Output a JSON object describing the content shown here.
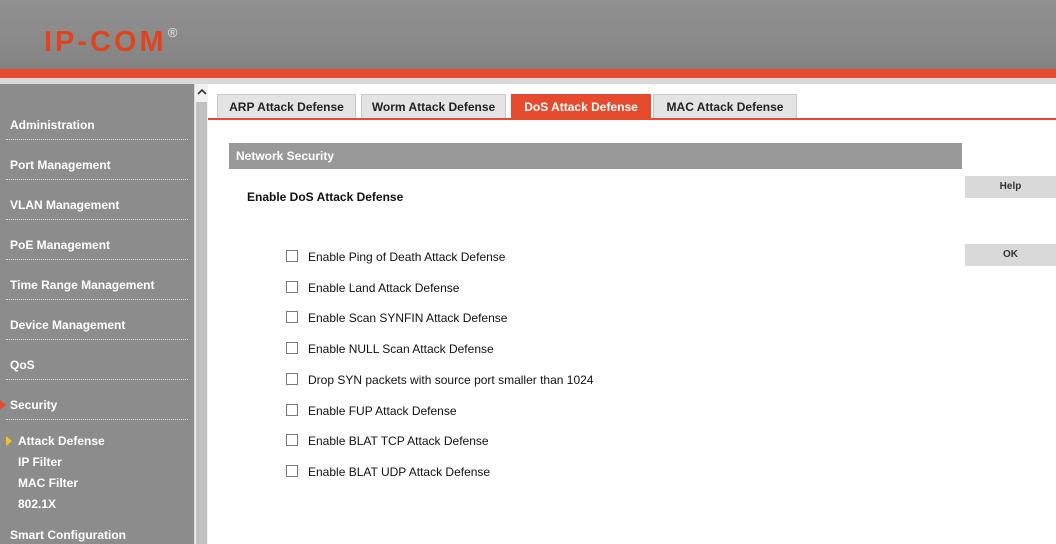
{
  "header": {
    "logo_text": "IP-COM",
    "logo_mark": "®",
    "accent_color": "#e54b2c"
  },
  "sidebar": {
    "items": [
      {
        "label": "Administration"
      },
      {
        "label": "Port Management"
      },
      {
        "label": "VLAN Management"
      },
      {
        "label": "PoE Management"
      },
      {
        "label": "Time Range Management"
      },
      {
        "label": "Device Management"
      },
      {
        "label": "QoS"
      },
      {
        "label": "Security",
        "active": true
      },
      {
        "label": "Smart Configuration"
      }
    ],
    "security_submenu": [
      {
        "label": "Attack Defense",
        "active": true
      },
      {
        "label": "IP Filter"
      },
      {
        "label": "MAC Filter"
      },
      {
        "label": "802.1X"
      }
    ],
    "scroll_up_icon": "chevron-up-icon"
  },
  "tabs": [
    {
      "label": "ARP Attack Defense"
    },
    {
      "label": "Worm Attack Defense"
    },
    {
      "label": "DoS Attack Defense",
      "active": true
    },
    {
      "label": "MAC Attack Defense"
    }
  ],
  "content": {
    "section_title": "Network Security",
    "enable_title": "Enable DoS Attack Defense",
    "options": [
      {
        "label": "Enable Ping of Death Attack Defense",
        "checked": false
      },
      {
        "label": "Enable Land Attack Defense",
        "checked": false
      },
      {
        "label": "Enable Scan SYNFIN Attack Defense",
        "checked": false
      },
      {
        "label": "Enable NULL Scan Attack Defense",
        "checked": false
      },
      {
        "label": "Drop SYN packets with source port smaller than 1024",
        "checked": false
      },
      {
        "label": "Enable FUP Attack Defense",
        "checked": false
      },
      {
        "label": "Enable BLAT TCP Attack Defense",
        "checked": false
      },
      {
        "label": "Enable BLAT UDP Attack Defense",
        "checked": false
      }
    ]
  },
  "buttons": {
    "help_label": "Help",
    "ok_label": "OK"
  }
}
